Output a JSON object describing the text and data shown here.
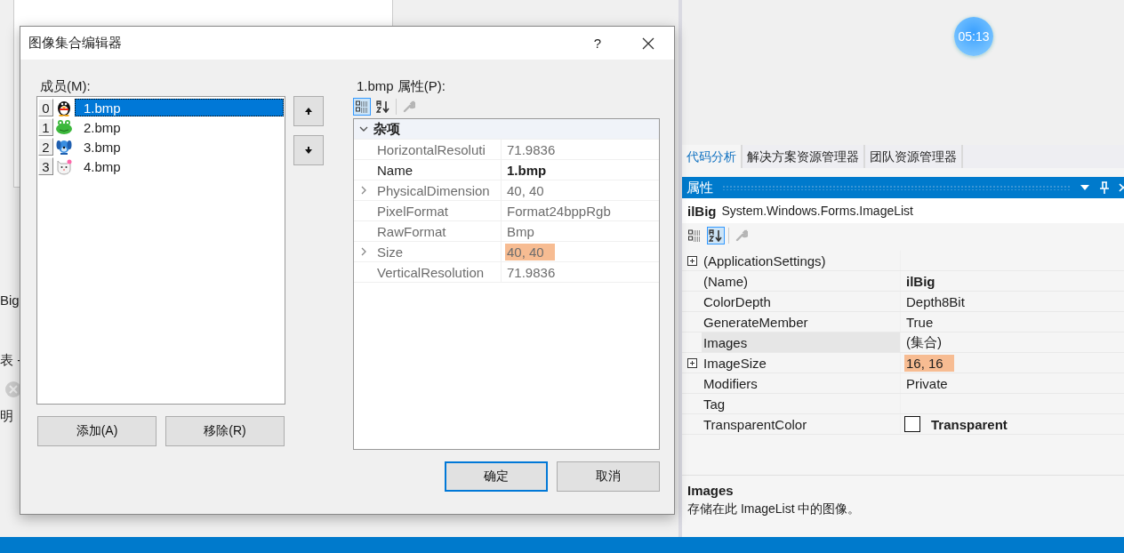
{
  "background": {
    "fragments": [
      "Big",
      "表 -",
      "明"
    ],
    "clock": "05:13"
  },
  "dialog": {
    "title": "图像集合编辑器",
    "help": "?",
    "members_label": "成员(M):",
    "members": [
      {
        "index": "0",
        "name": "1.bmp",
        "selected": true
      },
      {
        "index": "1",
        "name": "2.bmp",
        "selected": false
      },
      {
        "index": "2",
        "name": "3.bmp",
        "selected": false
      },
      {
        "index": "3",
        "name": "4.bmp",
        "selected": false
      }
    ],
    "properties_label": "1.bmp 属性(P):",
    "toolbar": [
      {
        "kind": "categorized",
        "selected": true
      },
      {
        "kind": "alphabetical",
        "selected": false
      },
      {
        "kind": "pages",
        "selected": false
      }
    ],
    "grid": [
      {
        "kind": "category",
        "label": "杂项",
        "expanded": true
      },
      {
        "kind": "property",
        "name": "HorizontalResoluti",
        "value": "71.9836",
        "readonly": true,
        "expandable": false,
        "bold": false,
        "highlighted": false,
        "selected": false
      },
      {
        "kind": "property",
        "name": "Name",
        "value": "1.bmp",
        "readonly": false,
        "expandable": false,
        "bold": true,
        "highlighted": false,
        "selected": false
      },
      {
        "kind": "property",
        "name": "PhysicalDimension",
        "value": "40, 40",
        "readonly": true,
        "expandable": true,
        "bold": false,
        "highlighted": false,
        "selected": false
      },
      {
        "kind": "property",
        "name": "PixelFormat",
        "value": "Format24bppRgb",
        "readonly": true,
        "expandable": false,
        "bold": false,
        "highlighted": false,
        "selected": false
      },
      {
        "kind": "property",
        "name": "RawFormat",
        "value": "Bmp",
        "readonly": true,
        "expandable": false,
        "bold": false,
        "highlighted": false,
        "selected": false
      },
      {
        "kind": "property",
        "name": "Size",
        "value": "40, 40",
        "readonly": true,
        "expandable": true,
        "bold": false,
        "highlighted": true,
        "selected": false
      },
      {
        "kind": "property",
        "name": "VerticalResolution",
        "value": "71.9836",
        "readonly": true,
        "expandable": false,
        "bold": false,
        "highlighted": false,
        "selected": false
      }
    ],
    "buttons": {
      "add": "添加(A)",
      "remove": "移除(R)",
      "ok": "确定",
      "cancel": "取消"
    }
  },
  "ide": {
    "tabs": [
      {
        "label": "代码分析",
        "selected": true
      },
      {
        "label": "解决方案资源管理器",
        "selected": false
      },
      {
        "label": "团队资源管理器",
        "selected": false
      }
    ],
    "panel_title": "属性",
    "object_name": "ilBig",
    "object_type": "System.Windows.Forms.ImageList",
    "toolbar": [
      {
        "kind": "categorized",
        "selected": false
      },
      {
        "kind": "alphabetical",
        "selected": true
      },
      {
        "kind": "pages",
        "selected": false
      }
    ],
    "grid": [
      {
        "kind": "property",
        "name": "(ApplicationSettings)",
        "readonly": false,
        "expandable": true,
        "selected": false
      },
      {
        "kind": "property",
        "name": "(Name)",
        "value": "ilBig",
        "readonly": false,
        "expandable": false,
        "bold": true,
        "highlighted": false,
        "selected": false
      },
      {
        "kind": "property",
        "name": "ColorDepth",
        "value": "Depth8Bit",
        "readonly": false,
        "expandable": false,
        "bold": false,
        "highlighted": false,
        "selected": false
      },
      {
        "kind": "property",
        "name": "GenerateMember",
        "value": "True",
        "readonly": false,
        "expandable": false,
        "bold": false,
        "highlighted": false,
        "selected": false
      },
      {
        "kind": "property",
        "name": "Images",
        "value": "(集合)",
        "readonly": false,
        "expandable": false,
        "bold": false,
        "highlighted": false,
        "selected": true
      },
      {
        "kind": "property",
        "name": "ImageSize",
        "value": "16, 16",
        "readonly": false,
        "expandable": true,
        "bold": false,
        "highlighted": true,
        "selected": false
      },
      {
        "kind": "property",
        "name": "Modifiers",
        "value": "Private",
        "readonly": false,
        "expandable": false,
        "bold": false,
        "highlighted": false,
        "selected": false
      },
      {
        "kind": "property",
        "name": "Tag",
        "readonly": false,
        "expandable": false,
        "selected": false
      },
      {
        "kind": "color",
        "name": "TransparentColor",
        "value": "Transparent",
        "readonly": false,
        "expandable": false,
        "bold": true,
        "highlighted": false,
        "selected": false
      }
    ],
    "description": {
      "title": "Images",
      "text": "存储在此 ImageList 中的图像。"
    }
  }
}
